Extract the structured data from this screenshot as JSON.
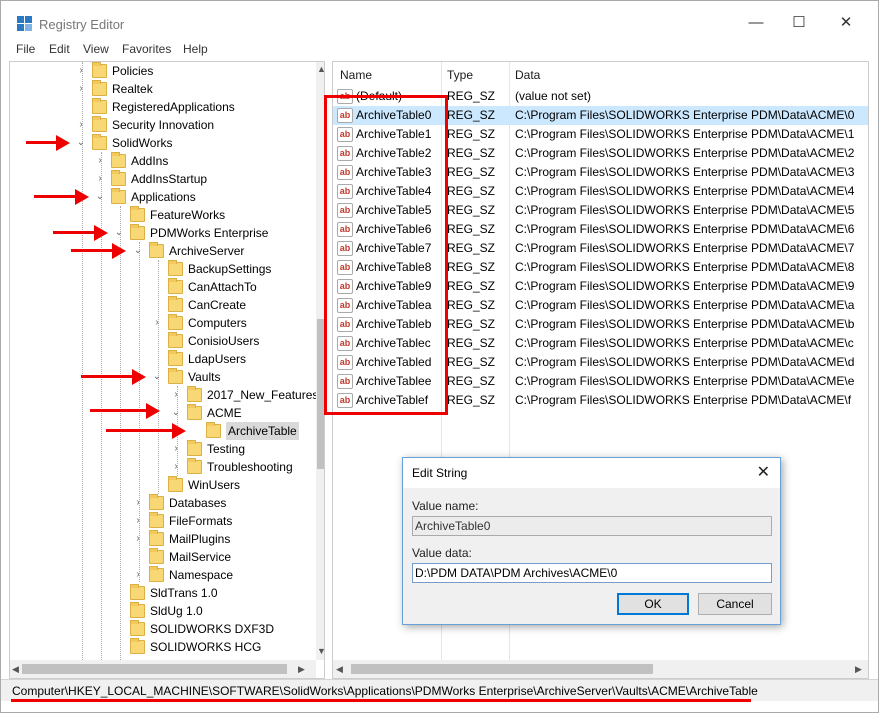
{
  "window": {
    "title": "Registry Editor",
    "minimize": "—",
    "maximize": "☐",
    "close": "✕"
  },
  "menu": [
    "File",
    "Edit",
    "View",
    "Favorites",
    "Help"
  ],
  "tree": [
    {
      "label": "Policies"
    },
    {
      "label": "Realtek"
    },
    {
      "label": "RegisteredApplications"
    },
    {
      "label": "Security Innovation"
    },
    {
      "label": "SolidWorks"
    },
    {
      "label": "AddIns"
    },
    {
      "label": "AddInsStartup"
    },
    {
      "label": "Applications"
    },
    {
      "label": "FeatureWorks"
    },
    {
      "label": "PDMWorks Enterprise"
    },
    {
      "label": "ArchiveServer"
    },
    {
      "label": "BackupSettings"
    },
    {
      "label": "CanAttachTo"
    },
    {
      "label": "CanCreate"
    },
    {
      "label": "Computers"
    },
    {
      "label": "ConisioUsers"
    },
    {
      "label": "LdapUsers"
    },
    {
      "label": "Vaults"
    },
    {
      "label": "2017_New_Features"
    },
    {
      "label": "ACME"
    },
    {
      "label": "ArchiveTable"
    },
    {
      "label": "Testing"
    },
    {
      "label": "Troubleshooting"
    },
    {
      "label": "WinUsers"
    },
    {
      "label": "Databases"
    },
    {
      "label": "FileFormats"
    },
    {
      "label": "MailPlugins"
    },
    {
      "label": "MailService"
    },
    {
      "label": "Namespace"
    },
    {
      "label": "SldTrans 1.0"
    },
    {
      "label": "SldUg 1.0"
    },
    {
      "label": "SOLIDWORKS DXF3D"
    },
    {
      "label": "SOLIDWORKS HCG"
    }
  ],
  "list": {
    "columns": [
      "Name",
      "Type",
      "Data"
    ],
    "rows": [
      {
        "name": "(Default)",
        "type": "REG_SZ",
        "data": "(value not set)"
      },
      {
        "name": "ArchiveTable0",
        "type": "REG_SZ",
        "data": "C:\\Program Files\\SOLIDWORKS Enterprise PDM\\Data\\ACME\\0"
      },
      {
        "name": "ArchiveTable1",
        "type": "REG_SZ",
        "data": "C:\\Program Files\\SOLIDWORKS Enterprise PDM\\Data\\ACME\\1"
      },
      {
        "name": "ArchiveTable2",
        "type": "REG_SZ",
        "data": "C:\\Program Files\\SOLIDWORKS Enterprise PDM\\Data\\ACME\\2"
      },
      {
        "name": "ArchiveTable3",
        "type": "REG_SZ",
        "data": "C:\\Program Files\\SOLIDWORKS Enterprise PDM\\Data\\ACME\\3"
      },
      {
        "name": "ArchiveTable4",
        "type": "REG_SZ",
        "data": "C:\\Program Files\\SOLIDWORKS Enterprise PDM\\Data\\ACME\\4"
      },
      {
        "name": "ArchiveTable5",
        "type": "REG_SZ",
        "data": "C:\\Program Files\\SOLIDWORKS Enterprise PDM\\Data\\ACME\\5"
      },
      {
        "name": "ArchiveTable6",
        "type": "REG_SZ",
        "data": "C:\\Program Files\\SOLIDWORKS Enterprise PDM\\Data\\ACME\\6"
      },
      {
        "name": "ArchiveTable7",
        "type": "REG_SZ",
        "data": "C:\\Program Files\\SOLIDWORKS Enterprise PDM\\Data\\ACME\\7"
      },
      {
        "name": "ArchiveTable8",
        "type": "REG_SZ",
        "data": "C:\\Program Files\\SOLIDWORKS Enterprise PDM\\Data\\ACME\\8"
      },
      {
        "name": "ArchiveTable9",
        "type": "REG_SZ",
        "data": "C:\\Program Files\\SOLIDWORKS Enterprise PDM\\Data\\ACME\\9"
      },
      {
        "name": "ArchiveTablea",
        "type": "REG_SZ",
        "data": "C:\\Program Files\\SOLIDWORKS Enterprise PDM\\Data\\ACME\\a"
      },
      {
        "name": "ArchiveTableb",
        "type": "REG_SZ",
        "data": "C:\\Program Files\\SOLIDWORKS Enterprise PDM\\Data\\ACME\\b"
      },
      {
        "name": "ArchiveTablec",
        "type": "REG_SZ",
        "data": "C:\\Program Files\\SOLIDWORKS Enterprise PDM\\Data\\ACME\\c"
      },
      {
        "name": "ArchiveTabled",
        "type": "REG_SZ",
        "data": "C:\\Program Files\\SOLIDWORKS Enterprise PDM\\Data\\ACME\\d"
      },
      {
        "name": "ArchiveTablee",
        "type": "REG_SZ",
        "data": "C:\\Program Files\\SOLIDWORKS Enterprise PDM\\Data\\ACME\\e"
      },
      {
        "name": "ArchiveTablef",
        "type": "REG_SZ",
        "data": "C:\\Program Files\\SOLIDWORKS Enterprise PDM\\Data\\ACME\\f"
      }
    ]
  },
  "status": {
    "path": "Computer\\HKEY_LOCAL_MACHINE\\SOFTWARE\\SolidWorks\\Applications\\PDMWorks Enterprise\\ArchiveServer\\Vaults\\ACME\\ArchiveTable"
  },
  "dialog": {
    "title": "Edit String",
    "value_name_label": "Value name:",
    "value_name": "ArchiveTable0",
    "value_data_label": "Value data:",
    "value_data": "D:\\PDM DATA\\PDM Archives\\ACME\\0",
    "ok": "OK",
    "cancel": "Cancel"
  },
  "colors": {
    "annotation": "#e00000",
    "selection": "#cce8ff",
    "folder": "#f8d775"
  }
}
